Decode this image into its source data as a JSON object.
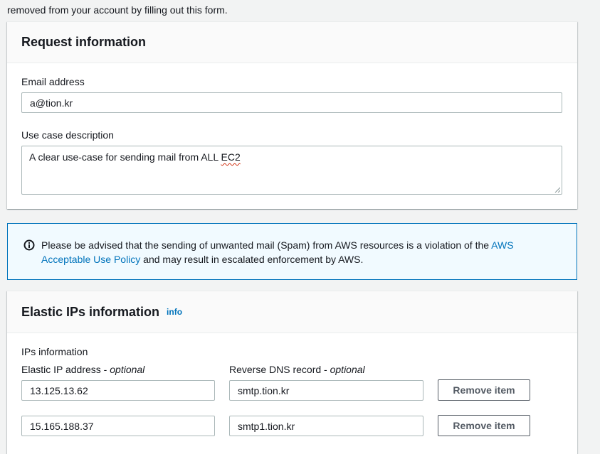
{
  "intro": {
    "text": "removed from your account by filling out this form."
  },
  "request_panel": {
    "title": "Request information",
    "email_label": "Email address",
    "email_value": "a@tion.kr",
    "use_case_label": "Use case description",
    "use_case_value_prefix": "A clear use-case for sending mail from ALL ",
    "use_case_value_flagged": "EC2"
  },
  "alert": {
    "icon": "info-circle-icon",
    "text_before": "Please be advised that the sending of unwanted mail (Spam) from AWS resources is a violation of the ",
    "link_text": "AWS Acceptable Use Policy",
    "text_after": " and may result in escalated enforcement by AWS."
  },
  "elastic_panel": {
    "title": "Elastic IPs information",
    "info_link": "info",
    "section_label": "IPs information",
    "ip_label": "Elastic IP address",
    "ip_optional": "optional",
    "dns_label": "Reverse DNS record",
    "dns_optional": "optional",
    "optional_sep": " - ",
    "rows": [
      {
        "ip": "13.125.13.62",
        "dns": "smtp.tion.kr",
        "remove_label": "Remove item"
      },
      {
        "ip": "15.165.188.37",
        "dns": "smtp1.tion.kr",
        "remove_label": "Remove item"
      }
    ]
  },
  "colors": {
    "link": "#0073bb",
    "alert_bg": "#f1faff",
    "alert_border": "#0073bb",
    "panel_header_bg": "#fafafa",
    "input_border": "#aab7b8"
  }
}
